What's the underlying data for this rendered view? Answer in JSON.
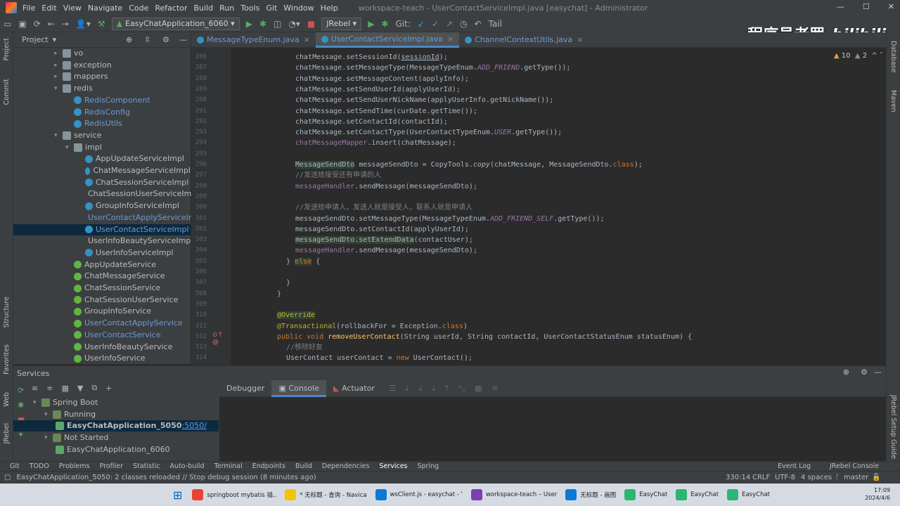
{
  "titlebar": {
    "menu": [
      "File",
      "Edit",
      "View",
      "Navigate",
      "Code",
      "Refactor",
      "Build",
      "Run",
      "Tools",
      "Git",
      "Window",
      "Help"
    ],
    "title": "workspace-teach - UserContactServiceImpl.java [easychat] - Administrator"
  },
  "toolbar": {
    "run_config": "EasyChatApplication_6060",
    "jrebel": "JRebel",
    "git_label": "Git:",
    "tail": "Tail"
  },
  "watermark": {
    "author": "程序员老罗",
    "site": "bilibili"
  },
  "left_strip": [
    "Project",
    "Commit",
    "Structure",
    "Favorites",
    "Web",
    "JRebel"
  ],
  "right_strip": [
    "Database",
    "Maven",
    "JRebel Setup Guide"
  ],
  "project": {
    "title": "Project",
    "tree": [
      {
        "label": "vo",
        "kind": "folder",
        "indent": 1,
        "arrow": "▸"
      },
      {
        "label": "exception",
        "kind": "folder",
        "indent": 1,
        "arrow": "▸"
      },
      {
        "label": "mappers",
        "kind": "folder",
        "indent": 1,
        "arrow": "▸"
      },
      {
        "label": "redis",
        "kind": "folder",
        "indent": 1,
        "arrow": "▾"
      },
      {
        "label": "RedisComponent",
        "kind": "cls",
        "indent": 2,
        "color": "blue"
      },
      {
        "label": "RedisConfig",
        "kind": "cls",
        "indent": 2,
        "color": "blue"
      },
      {
        "label": "RedisUtils",
        "kind": "cls",
        "indent": 2,
        "color": "blue"
      },
      {
        "label": "service",
        "kind": "folder",
        "indent": 1,
        "arrow": "▾"
      },
      {
        "label": "impl",
        "kind": "folder",
        "indent": 2,
        "arrow": "▾"
      },
      {
        "label": "AppUpdateServiceImpl",
        "kind": "cls",
        "indent": 3
      },
      {
        "label": "ChatMessageServiceImpl",
        "kind": "cls",
        "indent": 3
      },
      {
        "label": "ChatSessionServiceImpl",
        "kind": "cls",
        "indent": 3
      },
      {
        "label": "ChatSessionUserServiceImpl",
        "kind": "cls",
        "indent": 3
      },
      {
        "label": "GroupInfoServiceImpl",
        "kind": "cls",
        "indent": 3
      },
      {
        "label": "UserContactApplyServiceImpl",
        "kind": "cls",
        "indent": 3,
        "color": "blue"
      },
      {
        "label": "UserContactServiceImpl",
        "kind": "cls",
        "indent": 3,
        "color": "blue",
        "selected": true
      },
      {
        "label": "UserInfoBeautyServiceImpl",
        "kind": "cls",
        "indent": 3
      },
      {
        "label": "UserInfoServiceImpl",
        "kind": "cls",
        "indent": 3
      },
      {
        "label": "AppUpdateService",
        "kind": "intf",
        "indent": 2
      },
      {
        "label": "ChatMessageService",
        "kind": "intf",
        "indent": 2
      },
      {
        "label": "ChatSessionService",
        "kind": "intf",
        "indent": 2
      },
      {
        "label": "ChatSessionUserService",
        "kind": "intf",
        "indent": 2
      },
      {
        "label": "GroupInfoService",
        "kind": "intf",
        "indent": 2
      },
      {
        "label": "UserContactApplyService",
        "kind": "intf",
        "indent": 2,
        "color": "blue"
      },
      {
        "label": "UserContactService",
        "kind": "intf",
        "indent": 2,
        "color": "blue"
      },
      {
        "label": "UserInfoBeautyService",
        "kind": "intf",
        "indent": 2
      },
      {
        "label": "UserInfoService",
        "kind": "intf",
        "indent": 2
      }
    ]
  },
  "editor_tabs": [
    {
      "label": "MessageTypeEnum.java",
      "active": false
    },
    {
      "label": "UserContactServiceImpl.java",
      "active": true
    },
    {
      "label": "ChannelContextUtils.java",
      "active": false
    }
  ],
  "inspections": {
    "warnings": "10",
    "weak": "2"
  },
  "code_lines": [
    {
      "n": "286",
      "html": "chatMessage.setSessionId(<span class=\"hl2\">sessionId</span>);",
      "indent": 4
    },
    {
      "n": "287",
      "html": "chatMessage.setMessageType(MessageTypeEnum.<span class=\"fld it\">ADD_FRIEND</span>.getType());",
      "indent": 4
    },
    {
      "n": "288",
      "html": "chatMessage.setMessageContent(applyInfo);",
      "indent": 4
    },
    {
      "n": "289",
      "html": "chatMessage.setSendUserId(applyUserId);",
      "indent": 4
    },
    {
      "n": "290",
      "html": "chatMessage.setSendUserNickName(applyUserInfo.getNickName());",
      "indent": 4
    },
    {
      "n": "291",
      "html": "chatMessage.setSendTime(curDate.getTime());",
      "indent": 4
    },
    {
      "n": "292",
      "html": "chatMessage.setContactId(contactId);",
      "indent": 4
    },
    {
      "n": "293",
      "html": "chatMessage.setContactType(UserContactTypeEnum.<span class=\"fld it\">USER</span>.getType());",
      "indent": 4
    },
    {
      "n": "294",
      "html": "<span class=\"fld\">chatMessageMapper</span>.insert(chatMessage);",
      "indent": 4
    },
    {
      "n": "295",
      "html": "",
      "indent": 4
    },
    {
      "n": "296",
      "html": "<span class=\"hl\">MessageSendDto</span> messageSendDto = CopyTools.<span class=\"it\">copy</span>(chatMessage, MessageSendDto.<span class=\"kw\">class</span>);",
      "indent": 4
    },
    {
      "n": "297",
      "html": "<span class=\"cm\">//发送给接受还有申请的人</span>",
      "indent": 4
    },
    {
      "n": "298",
      "html": "<span class=\"fld\">messageHandler</span>.sendMessage(messageSendDto);",
      "indent": 4
    },
    {
      "n": "299",
      "html": "",
      "indent": 4
    },
    {
      "n": "300",
      "html": "<span class=\"cm\">//发送给申请人，发送人就是接受人，联系人就是申请人</span>",
      "indent": 4
    },
    {
      "n": "301",
      "html": "messageSendDto.setMessageType(MessageTypeEnum.<span class=\"fld it\">ADD_FRIEND_SELF</span>.getType());",
      "indent": 4
    },
    {
      "n": "302",
      "html": "messageSendDto.setContactId(applyUserId);",
      "indent": 4
    },
    {
      "n": "303",
      "html": "<span class=\"hl\">messageSendDto.setExtendData</span>(contactUser);",
      "indent": 4
    },
    {
      "n": "304",
      "html": "<span class=\"fld\">messageHandler</span>.sendMessage(messageSendDto);",
      "indent": 4
    },
    {
      "n": "305",
      "html": "} <span class=\"kw hl\">else</span> {",
      "indent": 3
    },
    {
      "n": "306",
      "html": "",
      "indent": 3
    },
    {
      "n": "307",
      "html": "}",
      "indent": 3
    },
    {
      "n": "308",
      "html": "}",
      "indent": 2
    },
    {
      "n": "309",
      "html": "",
      "indent": 2
    },
    {
      "n": "310",
      "html": "<span class=\"ann hl\">@Override</span>",
      "indent": 2
    },
    {
      "n": "311",
      "html": "<span class=\"ann\">@Transactional</span>(rollbackFor = Exception.<span class=\"kw\">class</span>)",
      "indent": 2
    },
    {
      "n": "312",
      "html": "<span class=\"kw\">public void</span> <span class=\"fn\">removeUserContact</span>(String userId, String contactId, UserContactStatusEnum statusEnum) {",
      "indent": 2
    },
    {
      "n": "313",
      "html": "<span class=\"cm\">//移除好友</span>",
      "indent": 3
    },
    {
      "n": "314",
      "html": "UserContact userContact = <span class=\"kw\">new</span> UserContact();",
      "indent": 3
    }
  ],
  "services": {
    "title": "Services",
    "tree": [
      {
        "label": "Spring Boot",
        "indent": 1,
        "arrow": "▾"
      },
      {
        "label": "Running",
        "indent": 2,
        "arrow": "▾"
      },
      {
        "label": "EasyChatApplication_5050",
        "link": ":5050/",
        "indent": 3,
        "selected": true
      },
      {
        "label": "Not Started",
        "indent": 2,
        "arrow": "▾"
      },
      {
        "label": "EasyChatApplication_6060",
        "indent": 3
      }
    ],
    "tabs": [
      "Debugger",
      "Console",
      "Actuator"
    ]
  },
  "bottom_tools": [
    "Git",
    "TODO",
    "Problems",
    "Profiler",
    "Statistic",
    "Auto-build",
    "Terminal",
    "Endpoints",
    "Build",
    "Dependencies",
    "Services",
    "Spring",
    "Event Log",
    "JRebel Console"
  ],
  "status": {
    "message": "EasyChatApplication_5050: 2 classes reloaded // Stop debug session (8 minutes ago)",
    "position": "330:14",
    "line_sep": "CRLF",
    "encoding": "UTF-8",
    "indent": "4 spaces",
    "branch": "master"
  },
  "taskbar": {
    "items": [
      "springboot mybatis 插..",
      "* 无标题 - 查询 - Navica",
      "wsClient.js - easychat - '",
      "workspace-teach – User",
      "无标题 - 画图",
      "EasyChat",
      "EasyChat",
      "EasyChat"
    ],
    "time": "17:09",
    "date": "2024/4/6"
  }
}
